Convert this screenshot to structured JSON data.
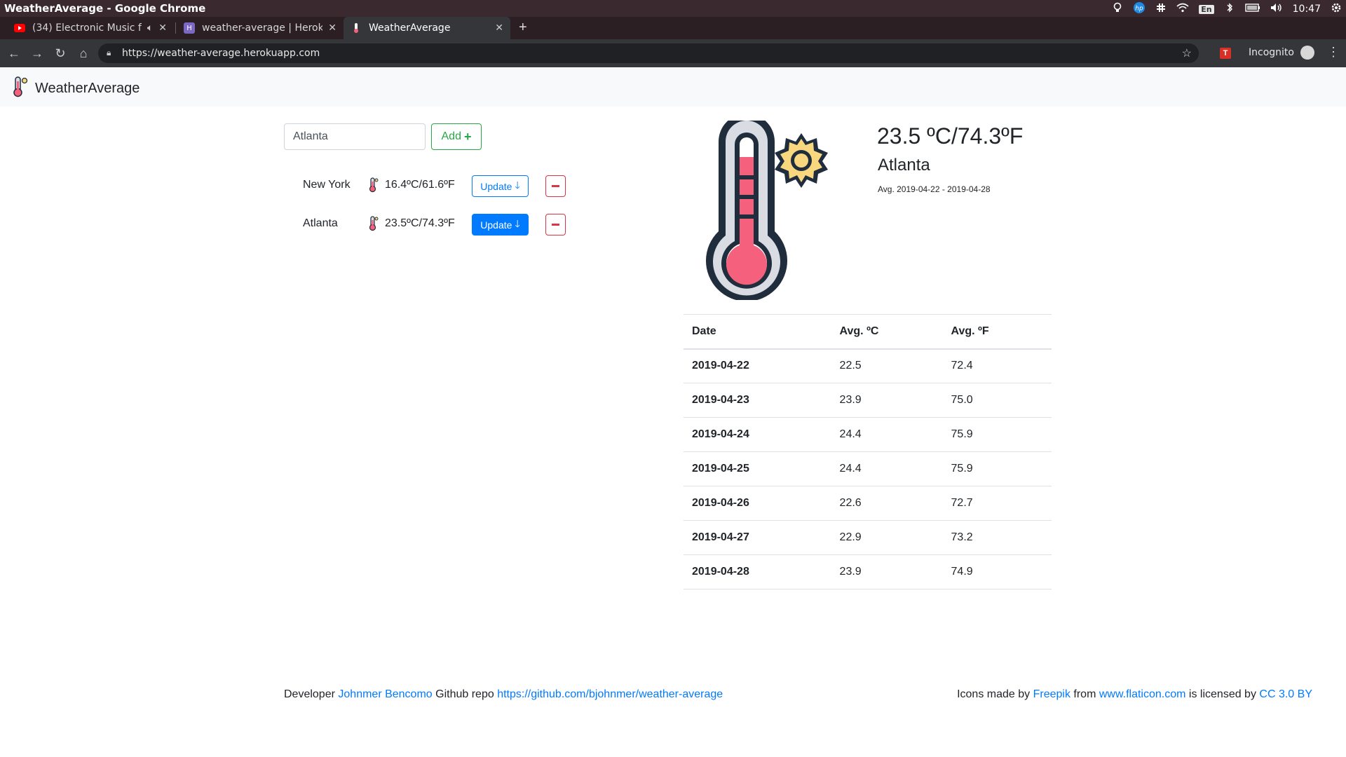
{
  "os": {
    "window_title": "WeatherAverage - Google Chrome",
    "lang": "En",
    "clock": "10:47"
  },
  "tabs": [
    {
      "label": "(34) Electronic Music f",
      "icon": "youtube-icon"
    },
    {
      "label": "weather-average | Heroku",
      "icon": "heroku-icon"
    },
    {
      "label": "WeatherAverage",
      "icon": "thermometer-icon"
    }
  ],
  "toolbar": {
    "url": "https://weather-average.herokuapp.com",
    "extension_badge": "T",
    "incognito_label": "Incognito"
  },
  "navbar": {
    "brand": "WeatherAverage"
  },
  "form": {
    "city_value": "Atlanta",
    "add_label": "Add",
    "add_icon": "+"
  },
  "cities": [
    {
      "name": "New York",
      "temp": "16.4ºC/61.6ºF",
      "update_label": "Update",
      "update_icon": "🡓"
    },
    {
      "name": "Atlanta",
      "temp": "23.5ºC/74.3ºF",
      "update_label": "Update",
      "update_icon": "🡓"
    }
  ],
  "current": {
    "temp": "23.5 ºC/74.3ºF",
    "city": "Atlanta",
    "range": "Avg. 2019-04-22 - 2019-04-28"
  },
  "table": {
    "headers": [
      "Date",
      "Avg. ºC",
      "Avg. ºF"
    ],
    "rows": [
      [
        "2019-04-22",
        "22.5",
        "72.4"
      ],
      [
        "2019-04-23",
        "23.9",
        "75.0"
      ],
      [
        "2019-04-24",
        "24.4",
        "75.9"
      ],
      [
        "2019-04-25",
        "24.4",
        "75.9"
      ],
      [
        "2019-04-26",
        "22.6",
        "72.7"
      ],
      [
        "2019-04-27",
        "22.9",
        "73.2"
      ],
      [
        "2019-04-28",
        "23.9",
        "74.9"
      ]
    ]
  },
  "footer": {
    "developer_prefix": "Developer",
    "developer_name": "Johnmer Bencomo",
    "repo_prefix": "Github repo",
    "repo_url": "https://github.com/bjohnmer/weather-average",
    "icons_prefix": "Icons made by",
    "icons_author": "Freepik",
    "from_word": "from",
    "icons_site": "www.flaticon.com",
    "license_prefix": "is licensed by",
    "license": "CC 3.0 BY"
  },
  "colors": {
    "primary": "#007bff",
    "success": "#28a745",
    "danger": "#dc3545",
    "thermo_red": "#f5617c",
    "sun_yellow": "#f8d77e"
  }
}
